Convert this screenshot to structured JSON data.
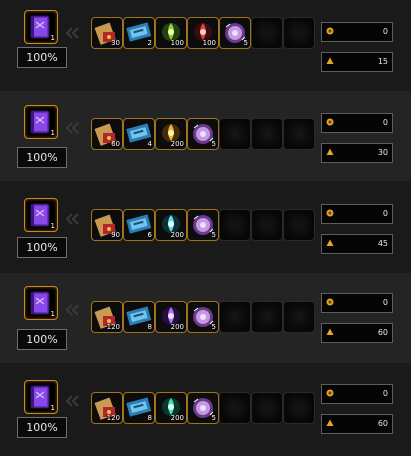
{
  "rows": [
    {
      "book": {
        "icon": "spellbook-icon",
        "qty": "1"
      },
      "rate": "100%",
      "ingredients": [
        {
          "icon": "scroll-red-icon",
          "qty": "30"
        },
        {
          "icon": "scroll-blue-icon",
          "qty": "2"
        },
        {
          "icon": "essence-green-icon",
          "qty": "100"
        },
        {
          "icon": "essence-red-icon",
          "qty": "100"
        },
        {
          "icon": "purple-orb-icon",
          "qty": "5"
        }
      ],
      "currency_1": {
        "icon": "gold-coin-icon",
        "value": "0"
      },
      "currency_2": {
        "icon": "honor-crest-icon",
        "value": "15"
      }
    },
    {
      "book": {
        "icon": "spellbook-icon",
        "qty": "1"
      },
      "rate": "100%",
      "ingredients": [
        {
          "icon": "scroll-red-icon",
          "qty": "60"
        },
        {
          "icon": "scroll-blue-icon",
          "qty": "4"
        },
        {
          "icon": "essence-gold-icon",
          "qty": "200"
        },
        {
          "icon": "purple-orb-icon",
          "qty": "5"
        }
      ],
      "currency_1": {
        "icon": "gold-coin-icon",
        "value": "0"
      },
      "currency_2": {
        "icon": "honor-crest-icon",
        "value": "30"
      }
    },
    {
      "book": {
        "icon": "spellbook-icon",
        "qty": "1"
      },
      "rate": "100%",
      "ingredients": [
        {
          "icon": "scroll-red-icon",
          "qty": "90"
        },
        {
          "icon": "scroll-blue-icon",
          "qty": "6"
        },
        {
          "icon": "essence-cyan-icon",
          "qty": "200"
        },
        {
          "icon": "purple-orb-icon",
          "qty": "5"
        }
      ],
      "currency_1": {
        "icon": "gold-coin-icon",
        "value": "0"
      },
      "currency_2": {
        "icon": "honor-crest-icon",
        "value": "45"
      }
    },
    {
      "book": {
        "icon": "spellbook-icon",
        "qty": "1"
      },
      "rate": "100%",
      "ingredients": [
        {
          "icon": "scroll-red-icon",
          "qty": "120"
        },
        {
          "icon": "scroll-blue-icon",
          "qty": "8"
        },
        {
          "icon": "essence-violet-icon",
          "qty": "200"
        },
        {
          "icon": "purple-orb-icon",
          "qty": "5"
        }
      ],
      "currency_1": {
        "icon": "gold-coin-icon",
        "value": "0"
      },
      "currency_2": {
        "icon": "honor-crest-icon",
        "value": "60"
      }
    },
    {
      "book": {
        "icon": "spellbook-icon",
        "qty": "1"
      },
      "rate": "100%",
      "ingredients": [
        {
          "icon": "scroll-red-icon",
          "qty": "120"
        },
        {
          "icon": "scroll-blue-icon",
          "qty": "8"
        },
        {
          "icon": "essence-teal-icon",
          "qty": "200"
        },
        {
          "icon": "purple-orb-icon",
          "qty": "5"
        }
      ],
      "currency_1": {
        "icon": "gold-coin-icon",
        "value": "0"
      },
      "currency_2": {
        "icon": "honor-crest-icon",
        "value": "60"
      }
    }
  ],
  "colors": {
    "slot_border": "#c88a1c",
    "essence_green": "#8fd13a",
    "essence_red": "#e0403a",
    "essence_gold": "#f2b23a",
    "essence_cyan": "#5fe0e8",
    "essence_violet": "#b070ff",
    "essence_teal": "#44e0b8"
  }
}
